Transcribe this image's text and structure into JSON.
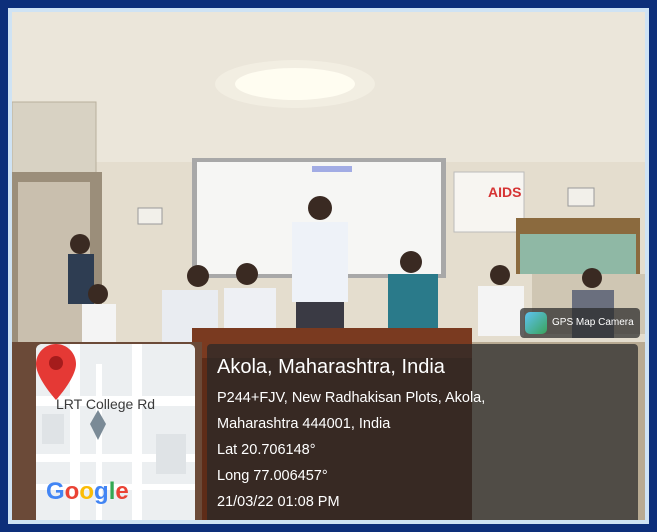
{
  "location": {
    "title": "Akola, Maharashtra, India",
    "address_line1": "P244+FJV, New Radhakisan Plots, Akola,",
    "address_line2": "Maharashtra 444001, India",
    "lat": "Lat 20.706148°",
    "long": "Long 77.006457°",
    "datetime": "21/03/22 01:08 PM"
  },
  "map": {
    "road_label": "LRT College Rd",
    "logo_text": "Google"
  },
  "app_badge": {
    "label": "GPS Map Camera",
    "icon": "gps-map-camera-icon"
  },
  "scene": {
    "poster_text": "AIDS"
  },
  "colors": {
    "frame": "#0d2f7a",
    "pin": "#e53935",
    "overlay": "#282828"
  }
}
